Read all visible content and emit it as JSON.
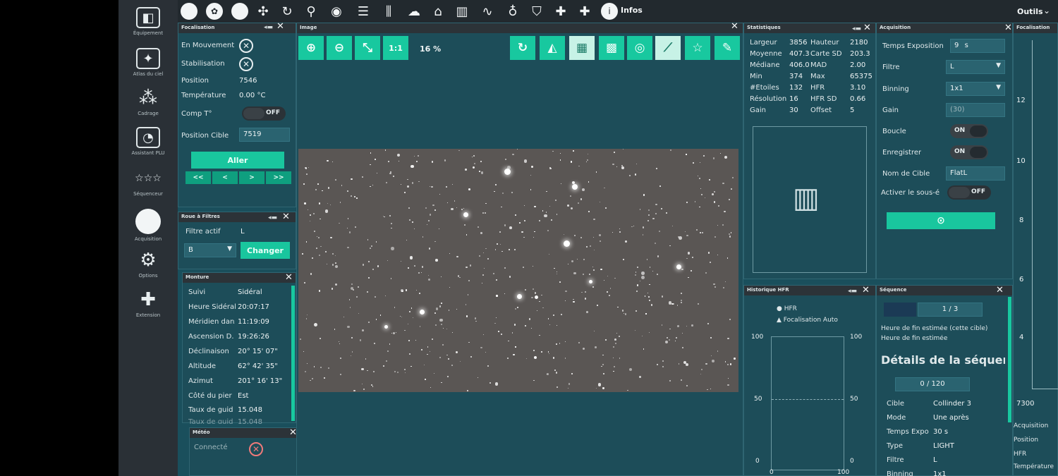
{
  "leftnav": {
    "items": [
      {
        "label": "Équipement",
        "icon": "camera-icon"
      },
      {
        "label": "Atlas du ciel",
        "icon": "sky-atlas-icon"
      },
      {
        "label": "Cadrage",
        "icon": "framing-icon"
      },
      {
        "label": "Assistant PLU",
        "icon": "flat-wizard-icon"
      },
      {
        "label": "Séquenceur",
        "icon": "sequencer-icon"
      },
      {
        "label": "Acquisition",
        "icon": "imaging-icon"
      },
      {
        "label": "Options",
        "icon": "gear-icon"
      },
      {
        "label": "Extension",
        "icon": "puzzle-icon"
      }
    ]
  },
  "toolbar": {
    "info_label": "Infos",
    "tools_label": "Outils"
  },
  "focuser": {
    "title": "Focalisation",
    "moving_label": "En Mouvement",
    "settling_label": "Stabilisation",
    "position_label": "Position",
    "position_value": "7546",
    "temperature_label": "Température",
    "temperature_value": "0.00 °C",
    "tempcomp_label": "Comp T°",
    "tempcomp_state": "OFF",
    "target_label": "Position Cible",
    "target_value": "7519",
    "go_label": "Aller",
    "step_buttons": [
      "<<",
      "<",
      ">",
      ">>"
    ]
  },
  "filterwheel": {
    "title": "Roue à Filtres",
    "active_label": "Filtre actif",
    "active_value": "L",
    "select_value": "B",
    "change_label": "Changer"
  },
  "mount": {
    "title": "Monture",
    "rows": [
      {
        "label": "Suivi",
        "value": "Sidéral"
      },
      {
        "label": "Heure Sidéral",
        "value": "20:07:17"
      },
      {
        "label": "Méridien dans",
        "value": "11:19:09"
      },
      {
        "label": "Ascension D.",
        "value": "19:26:26"
      },
      {
        "label": "Déclinaison",
        "value": "20° 15' 07\""
      },
      {
        "label": "Altitude",
        "value": "62° 42' 35\""
      },
      {
        "label": "Azimut",
        "value": "201° 16' 13\""
      },
      {
        "label": "Côté du pier",
        "value": "Est"
      },
      {
        "label": "Taux de guid",
        "value": "15.048"
      },
      {
        "label": "Taux de guid",
        "value": "15.048"
      }
    ]
  },
  "weather": {
    "title": "Météo",
    "connected_label": "Connecté"
  },
  "image": {
    "title": "Image",
    "zoom_fit": "1:1",
    "zoom_level": "16 %"
  },
  "statistics": {
    "title": "Statistiques",
    "rows": [
      {
        "l1": "Largeur",
        "v1": "3856",
        "l2": "Hauteur",
        "v2": "2180"
      },
      {
        "l1": "Moyenne",
        "v1": "407.3",
        "l2": "Carte SD",
        "v2": "203.3"
      },
      {
        "l1": "Médiane",
        "v1": "406.0",
        "l2": "MAD",
        "v2": "2.00"
      },
      {
        "l1": "Min",
        "v1": "374",
        "l2": "Max",
        "v2": "65375"
      },
      {
        "l1": "#Étoiles",
        "v1": "132",
        "l2": "HFR",
        "v2": "3.10"
      },
      {
        "l1": "Résolution",
        "v1": "16",
        "l2": "HFR SD",
        "v2": "0.66"
      },
      {
        "l1": "Gain",
        "v1": "30",
        "l2": "Offset",
        "v2": "5"
      }
    ]
  },
  "acquisition": {
    "title": "Acquisition",
    "exposure_label": "Temps Exposition",
    "exposure_value": "9",
    "exposure_unit": "s",
    "filter_label": "Filtre",
    "filter_value": "L",
    "binning_label": "Binning",
    "binning_value": "1x1",
    "gain_label": "Gain",
    "gain_value": "(30)",
    "loop_label": "Boucle",
    "loop_state": "ON",
    "save_label": "Enregistrer",
    "save_state": "ON",
    "target_label": "Nom de Cible",
    "target_value": "FlatL",
    "subsample_label": "Activer le sous-é",
    "subsample_state": "OFF"
  },
  "hfrhistory": {
    "title": "Historique HFR",
    "legend": [
      "HFR",
      "Focalisation Auto"
    ],
    "left_axis": [
      "100",
      "50",
      "0"
    ],
    "right_axis": [
      "100",
      "50",
      "0"
    ],
    "x_axis": [
      "0",
      "100"
    ]
  },
  "sequence": {
    "title": "Séquence",
    "progress": "1 / 3",
    "end_time_1": "Heure de fin estimée (cette cible)",
    "end_time_2": "Heure de fin estimée",
    "details_title": "Détails de la séquence",
    "count": "0 / 120",
    "rows": [
      {
        "label": "Cible",
        "value": "Collinder 3"
      },
      {
        "label": "Mode",
        "value": "Une après"
      },
      {
        "label": "Temps Expo",
        "value": "30 s"
      },
      {
        "label": "Type",
        "value": "LIGHT"
      },
      {
        "label": "Filtre",
        "value": "L"
      },
      {
        "label": "Binning",
        "value": "1x1"
      }
    ]
  },
  "focus_graph": {
    "title": "Focalisation",
    "y_ticks": [
      "12",
      "10",
      "8",
      "6",
      "4"
    ],
    "x_tick": "7300",
    "rows": [
      "Acquisition",
      "Position",
      "HFR",
      "Température"
    ]
  },
  "colors": {
    "accent": "#19c69e",
    "panel": "#1d4d59",
    "titlebar": "#2c3338"
  }
}
